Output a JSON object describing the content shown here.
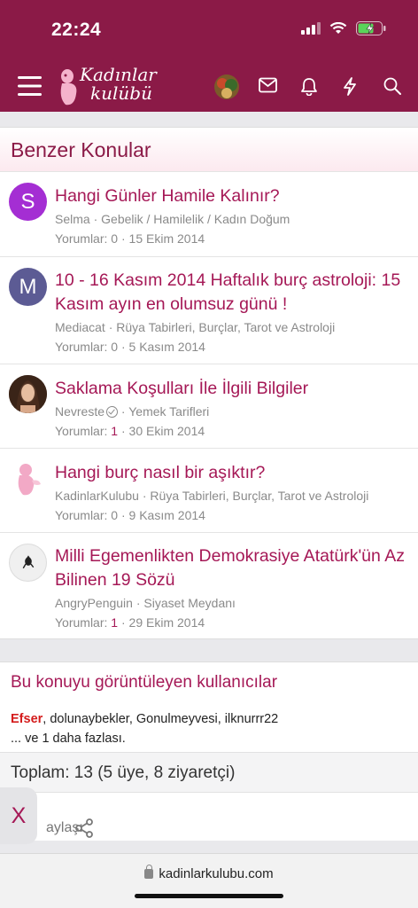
{
  "status_bar": {
    "time": "22:24"
  },
  "nav": {
    "logo_line1": "Kadınlar",
    "logo_line2": "kulübü"
  },
  "similar": {
    "heading": "Benzer Konular",
    "threads": [
      {
        "avatar_letter": "S",
        "avatar_color": "#a42ed3",
        "title": "Hangi Günler Hamile Kalınır?",
        "author": "Selma",
        "category": "Gebelik / Hamilelik / Kadın Doğum",
        "replies_label": "Yorumlar:",
        "replies": "0",
        "date": "15 Ekim 2014"
      },
      {
        "avatar_letter": "M",
        "avatar_color": "#5c5b94",
        "title": "10 - 16 Kasım 2014 Haftalık burç astroloji: 15 Kasım ayın en olumsuz günü !",
        "author": "Mediacat",
        "category": "Rüya Tabirleri, Burçlar, Tarot ve Astroloji",
        "replies_label": "Yorumlar:",
        "replies": "0",
        "date": "5 Kasım 2014"
      },
      {
        "avatar_letter": "",
        "avatar_color": "#5a3a2a",
        "title": "Saklama Koşulları İle İlgili Bilgiler",
        "author": "Nevreste",
        "category": "Yemek Tarifleri",
        "replies_label": "Yorumlar:",
        "replies": "1",
        "date": "30 Ekim 2014"
      },
      {
        "avatar_letter": "",
        "avatar_color": "#ffffff",
        "title": "Hangi burç nasıl bir aşıktır?",
        "author": "KadinlarKulubu",
        "category": "Rüya Tabirleri, Burçlar, Tarot ve Astroloji",
        "replies_label": "Yorumlar:",
        "replies": "0",
        "date": "9 Kasım 2014"
      },
      {
        "avatar_letter": "",
        "avatar_color": "#eeeeee",
        "title": "Milli Egemenlikten Demokrasiye Atatürk'ün Az Bilinen 19 Sözü",
        "author": "AngryPenguin",
        "category": "Siyaset Meydanı",
        "replies_label": "Yorumlar:",
        "replies": "1",
        "date": "29 Ekim 2014"
      }
    ]
  },
  "viewers": {
    "heading": "Bu konuyu görüntüleyen kullanıcılar",
    "highlight_user": "Efser",
    "other_users": ", dolunaybekler, Gonulmeyvesi, ilknurrr22",
    "more": "... ve 1 daha fazlası.",
    "totals": "Toplam: 13 (5 üye, 8 ziyaretçi)",
    "share_label": "aylaş:"
  },
  "close_label": "X",
  "browser": {
    "url": "kadinlarkulubu.com"
  },
  "colors": {
    "brand": "#8b1a47",
    "link": "#a51856"
  }
}
